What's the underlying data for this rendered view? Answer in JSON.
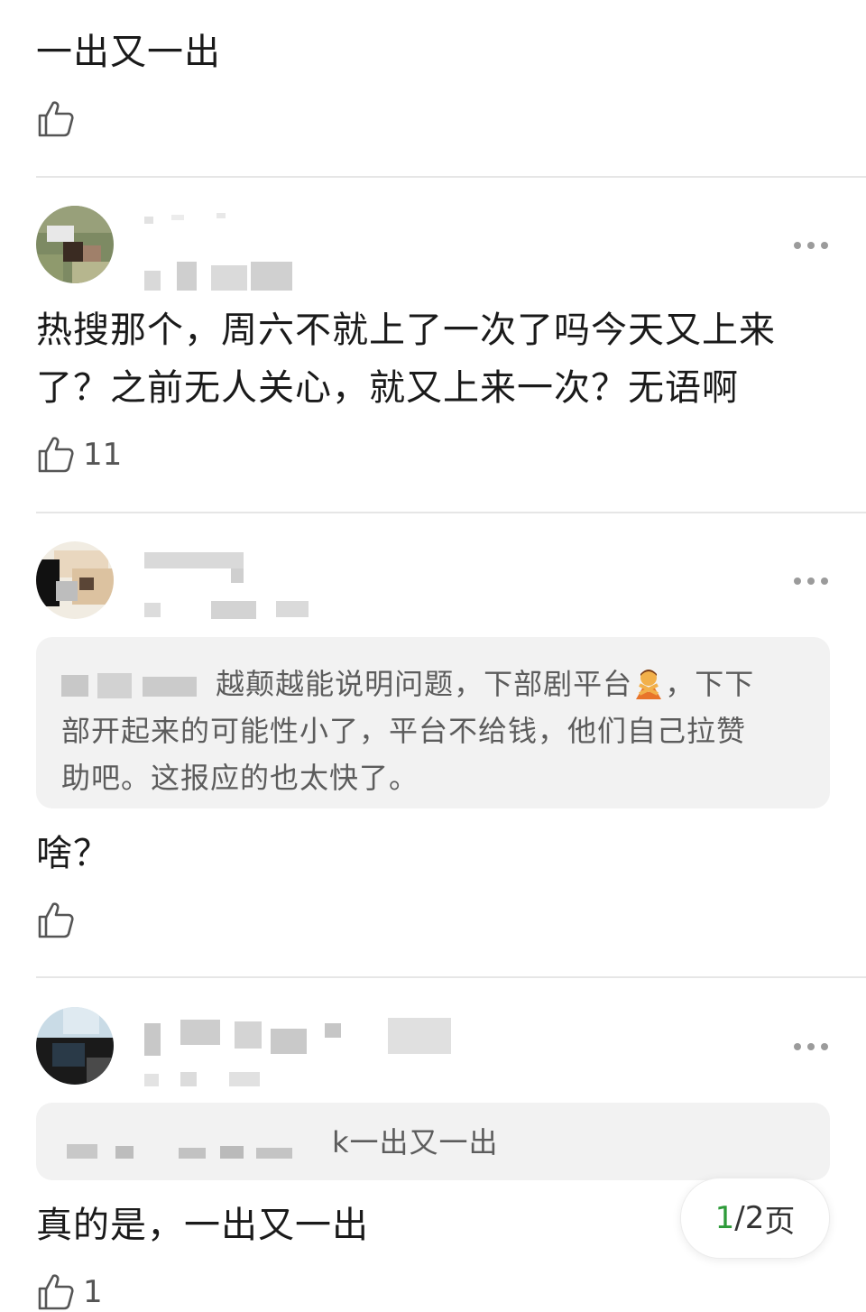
{
  "comments": [
    {
      "text": "一出又一出",
      "likes": ""
    },
    {
      "text_line1": "热搜那个，周六不就上了一次了吗今天又上来",
      "text_line2": "了？之前无人关心，就又上来一次？无语啊",
      "likes": "11"
    },
    {
      "quote_line1": "越颠越能说明问题，下部剧平台",
      "quote_line1_tail": "，下下",
      "quote_line2": "部开起来的可能性小了，平台不给钱，他们自己拉赞",
      "quote_line3": "助吧。这报应的也太快了。",
      "quote_emoji": "person-gesturing-no-emoji",
      "text": "啥？",
      "likes": ""
    },
    {
      "quote_tail": "k一出又一出",
      "text": "真的是，一出又一出",
      "likes": "1"
    }
  ],
  "pager": {
    "current": "1",
    "separator": "/",
    "total": "2",
    "unit": "页"
  },
  "icons": {
    "like": "thumbs-up-icon",
    "more": "more-dots-icon"
  },
  "colors": {
    "accent": "#2e9b3a",
    "divider": "#e6e6e6",
    "quote_bg": "#f2f2f2"
  }
}
